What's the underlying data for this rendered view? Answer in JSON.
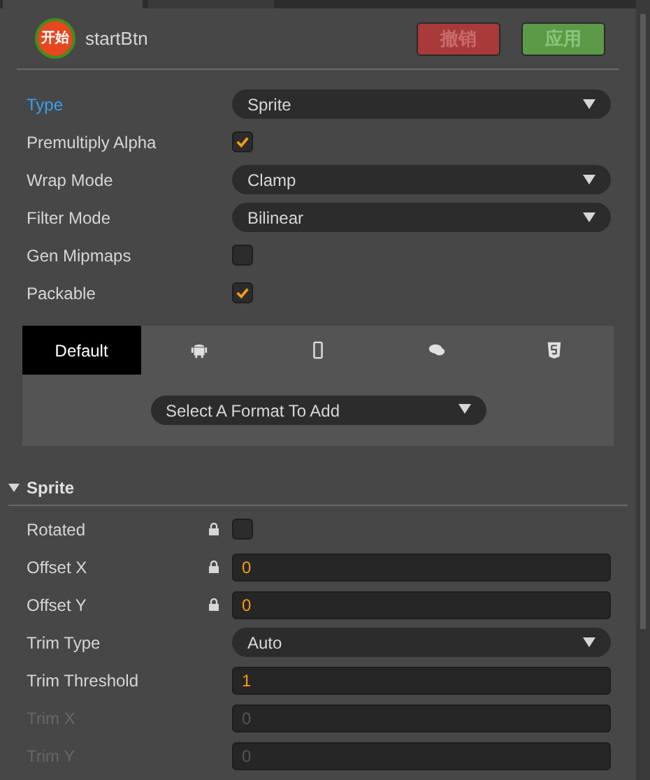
{
  "node": {
    "name": "startBtn",
    "icon_text": "开始"
  },
  "buttons": [
    {
      "label": "撤销",
      "kind": "revert"
    },
    {
      "label": "应用",
      "kind": "apply"
    }
  ],
  "properties": [
    {
      "label": "Type",
      "kind": "select",
      "value": "Sprite",
      "selected": true
    },
    {
      "label": "Premultiply Alpha",
      "kind": "checkbox",
      "checked": true,
      "selected": false
    },
    {
      "label": "Wrap Mode",
      "kind": "select",
      "value": "Clamp",
      "selected": false
    },
    {
      "label": "Filter Mode",
      "kind": "select",
      "value": "Bilinear",
      "selected": false
    },
    {
      "label": "Gen Mipmaps",
      "kind": "checkbox",
      "checked": false,
      "selected": false
    },
    {
      "label": "Packable",
      "kind": "checkbox",
      "checked": true,
      "selected": false
    }
  ],
  "platform_tabs": [
    {
      "kind": "text",
      "label": "Default",
      "selected": true
    },
    {
      "kind": "android",
      "selected": false
    },
    {
      "kind": "phone",
      "selected": false
    },
    {
      "kind": "chat",
      "selected": false
    },
    {
      "kind": "html5",
      "selected": false
    }
  ],
  "format_select": {
    "value": "Select A Format To Add"
  },
  "sprite": {
    "title": "Sprite",
    "expanded": true,
    "properties": [
      {
        "label": "Rotated",
        "kind": "checkbox",
        "locked": true,
        "checked": false,
        "disabled": false
      },
      {
        "label": "Offset X",
        "kind": "number",
        "locked": true,
        "value": "0",
        "disabled": false
      },
      {
        "label": "Offset Y",
        "kind": "number",
        "locked": true,
        "value": "0",
        "disabled": false
      },
      {
        "label": "Trim Type",
        "kind": "select",
        "locked": false,
        "value": "Auto",
        "disabled": false
      },
      {
        "label": "Trim Threshold",
        "kind": "number",
        "locked": false,
        "value": "1",
        "disabled": false
      },
      {
        "label": "Trim X",
        "kind": "number",
        "locked": false,
        "value": "0",
        "disabled": true
      },
      {
        "label": "Trim Y",
        "kind": "number",
        "locked": false,
        "value": "0",
        "disabled": true
      }
    ]
  }
}
